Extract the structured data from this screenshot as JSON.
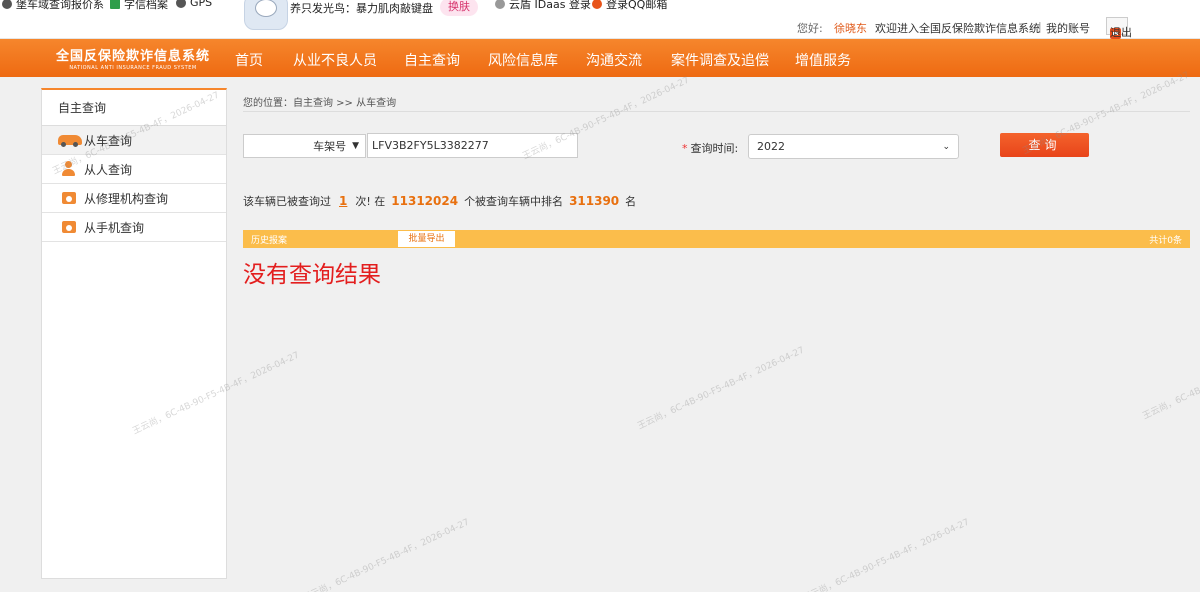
{
  "bookmarks": [
    {
      "label": "堡车域查询报价系"
    },
    {
      "label": "字信档案"
    },
    {
      "label": "GPS"
    },
    {
      "label": "云盾 IDaas 登录"
    },
    {
      "label": "登录QQ邮箱"
    }
  ],
  "popup": {
    "text": "养只发光鸟：暴力肌肉敲键盘",
    "button": "换肤"
  },
  "userbar": {
    "greeting": "您好:",
    "username": "徐晓东",
    "welcome": "欢迎进入全国反保险欺诈信息系统",
    "separator": "|",
    "my_account": "我的账号",
    "logout": "退出"
  },
  "logo": {
    "cn": "全国反保险欺诈信息系统",
    "en": "NATIONAL ANTI INSURANCE FRAUD SYSTEM"
  },
  "nav": [
    {
      "label": "首页"
    },
    {
      "label": "从业不良人员"
    },
    {
      "label": "自主查询"
    },
    {
      "label": "风险信息库"
    },
    {
      "label": "沟通交流"
    },
    {
      "label": "案件调查及追偿"
    },
    {
      "label": "增值服务"
    }
  ],
  "sidebar": {
    "title": "自主查询",
    "items": [
      {
        "label": "从车查询",
        "icon": "car-icon"
      },
      {
        "label": "从人查询",
        "icon": "person-icon"
      },
      {
        "label": "从修理机构查询",
        "icon": "repair-icon"
      },
      {
        "label": "从手机查询",
        "icon": "phone-icon"
      }
    ]
  },
  "breadcrumb": "您的位置：自主查询 >> 从车查询",
  "search": {
    "type_value": "车架号",
    "vin_value": "LFV3B2FY5L3382277",
    "time_label": "查询时间:",
    "time_required_mark": "*",
    "year_value": "2022",
    "query_button": "查询"
  },
  "count": {
    "prefix": "该车辆已被查询过",
    "times": "1",
    "mid1": "次! 在",
    "total": "11312024",
    "mid2": "个被查询车辆中排名",
    "rank": "311390",
    "suffix": "名"
  },
  "history": {
    "label": "历史报案",
    "export_button": "批量导出",
    "total": "共计0条"
  },
  "no_result": "没有查询结果",
  "watermark": "王云尚，6C-4B-90-F5-4B-4F，2026-04-27",
  "colors": {
    "nav_orange": "#f6862c",
    "history_bar": "#fbbd4b",
    "query_button": "#e8441a",
    "no_result": "#e31e1e",
    "highlight_number": "#e8700f"
  }
}
